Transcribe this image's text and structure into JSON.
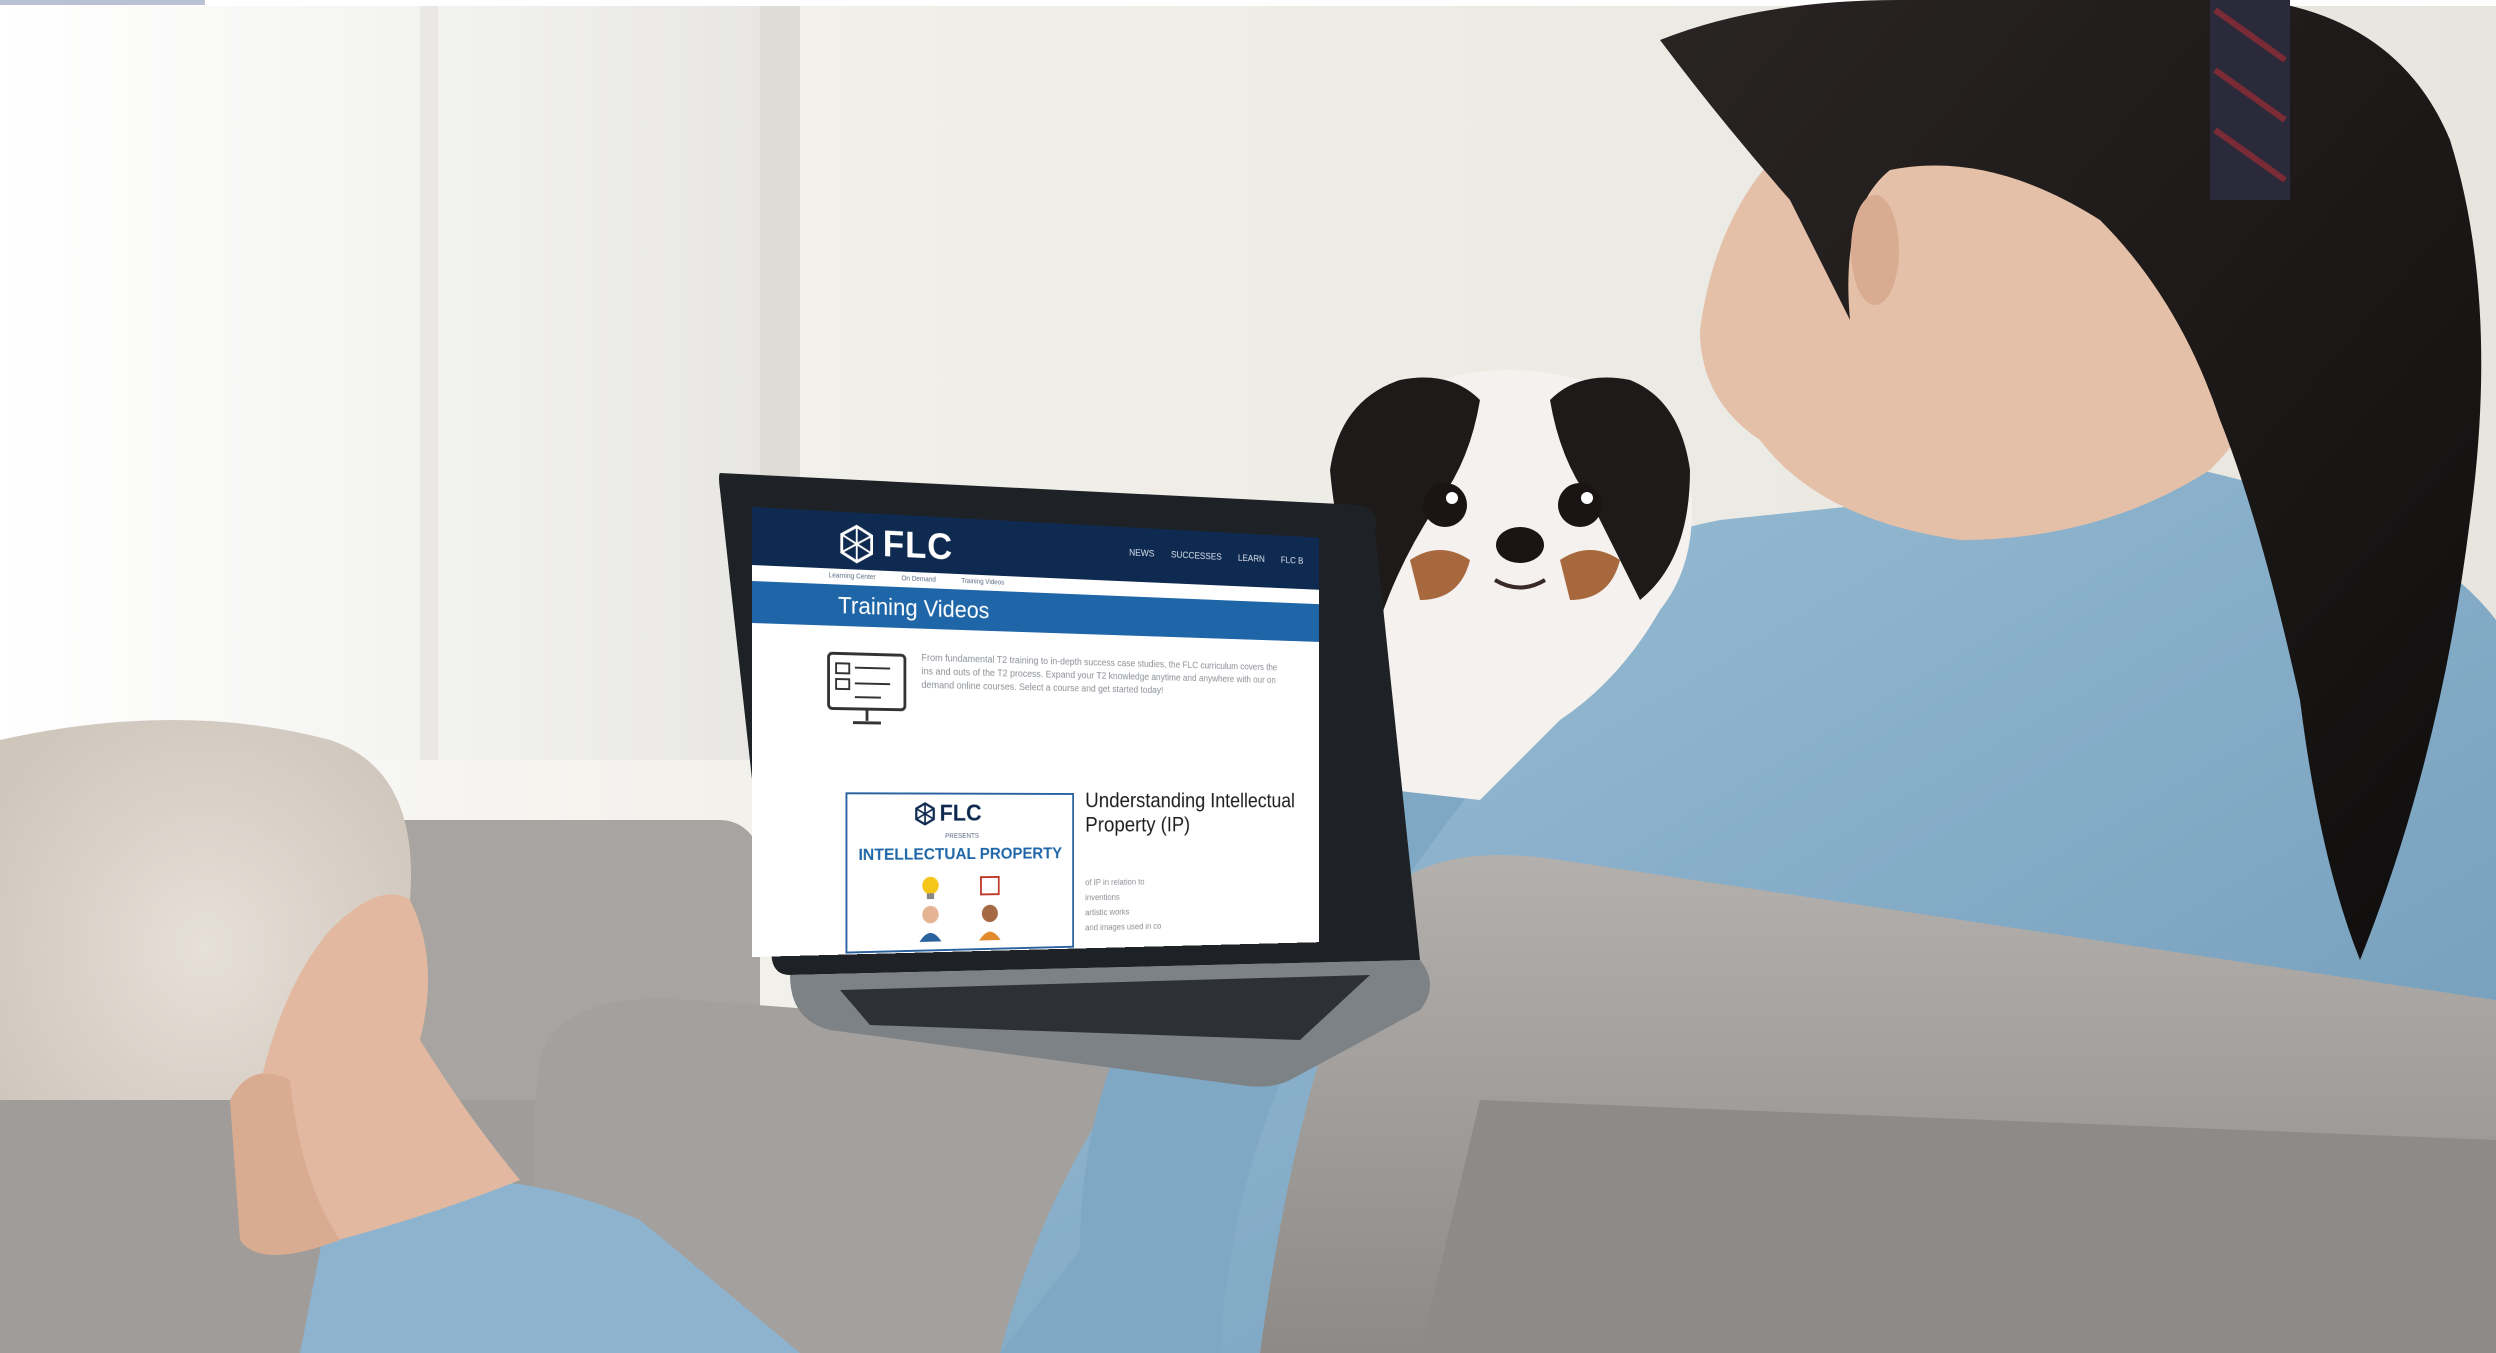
{
  "site": {
    "logo_text": "FLC",
    "nav": [
      "NEWS",
      "SUCCESSES",
      "LEARN",
      "FLC B"
    ],
    "breadcrumbs": [
      "Learning Center",
      "On Demand",
      "Training Videos"
    ],
    "page_title": "Training Videos",
    "intro": "From fundamental T2 training to in-depth success case studies, the FLC curriculum covers the ins and outs of the T2 process. Expand your T2 knowledge anytime and anywhere with our on demand online courses. Select a course and get started today!"
  },
  "course_card": {
    "logo_text": "FLC",
    "subtitle": "PRESENTS",
    "title": "INTELLECTUAL PROPERTY"
  },
  "course": {
    "title": "Understanding Intellectual Property (IP)",
    "description_lines": [
      "of IP in relation to",
      "inventions",
      "artistic works",
      "and images used in co"
    ]
  },
  "colors": {
    "header_navy": "#0f2a50",
    "title_blue": "#1f66a8",
    "shirt_blue": "#8fb3cc",
    "sofa_gray": "#a9a6a4",
    "hair": "#1b1818"
  },
  "icons": [
    "flc-logo-icon",
    "presentation-screen-icon",
    "lightbulb-icon",
    "person-icon"
  ]
}
